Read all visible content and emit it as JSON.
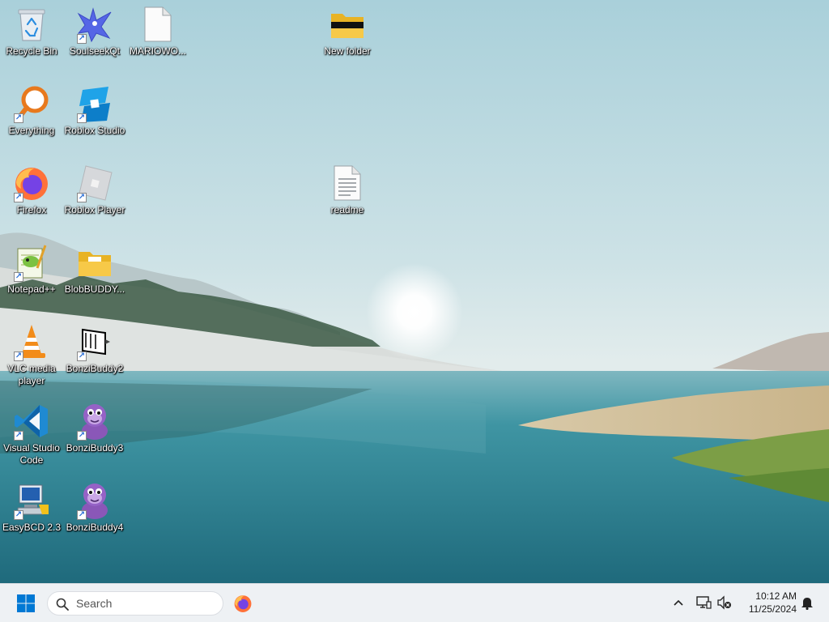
{
  "desktop": {
    "icons": [
      {
        "label": "Recycle Bin",
        "icon": "recycle-bin-icon"
      },
      {
        "label": "SoulseekQt",
        "icon": "soulseek-bird-icon"
      },
      {
        "label": "MARIOWO...",
        "icon": "blank-file-icon"
      },
      {
        "label": "New folder",
        "icon": "folder-icon"
      },
      {
        "label": "Everything",
        "icon": "everything-magnifier-icon"
      },
      {
        "label": "Roblox Studio",
        "icon": "roblox-studio-icon"
      },
      {
        "label": "Firefox",
        "icon": "firefox-icon"
      },
      {
        "label": "Roblox Player",
        "icon": "roblox-player-icon"
      },
      {
        "label": "readme",
        "icon": "text-document-icon"
      },
      {
        "label": "Notepad++",
        "icon": "notepadpp-icon"
      },
      {
        "label": "BlobBUDDY...",
        "icon": "folder-icon"
      },
      {
        "label": "VLC media player",
        "icon": "vlc-cone-icon"
      },
      {
        "label": "BonziBuddy2",
        "icon": "bonzibuddy2-icon"
      },
      {
        "label": "Visual Studio Code",
        "icon": "vscode-icon"
      },
      {
        "label": "BonziBuddy3",
        "icon": "bonzi-gorilla-icon"
      },
      {
        "label": "EasyBCD 2.3",
        "icon": "easybcd-icon"
      },
      {
        "label": "BonziBuddy4",
        "icon": "bonzi-gorilla-icon"
      }
    ]
  },
  "taskbar": {
    "search_placeholder": "Search",
    "pinned": [
      "firefox-icon"
    ],
    "tray": [
      "chevron-up-icon",
      "network-icon",
      "volume-muted-icon",
      "notification-bell-icon"
    ],
    "time": "10:12 AM",
    "date": "11/25/2024"
  },
  "colors": {
    "sky": "#c6dfe6",
    "water": "#2e7f91",
    "taskbar": "#eef1f4",
    "accent": "#0078d4"
  }
}
